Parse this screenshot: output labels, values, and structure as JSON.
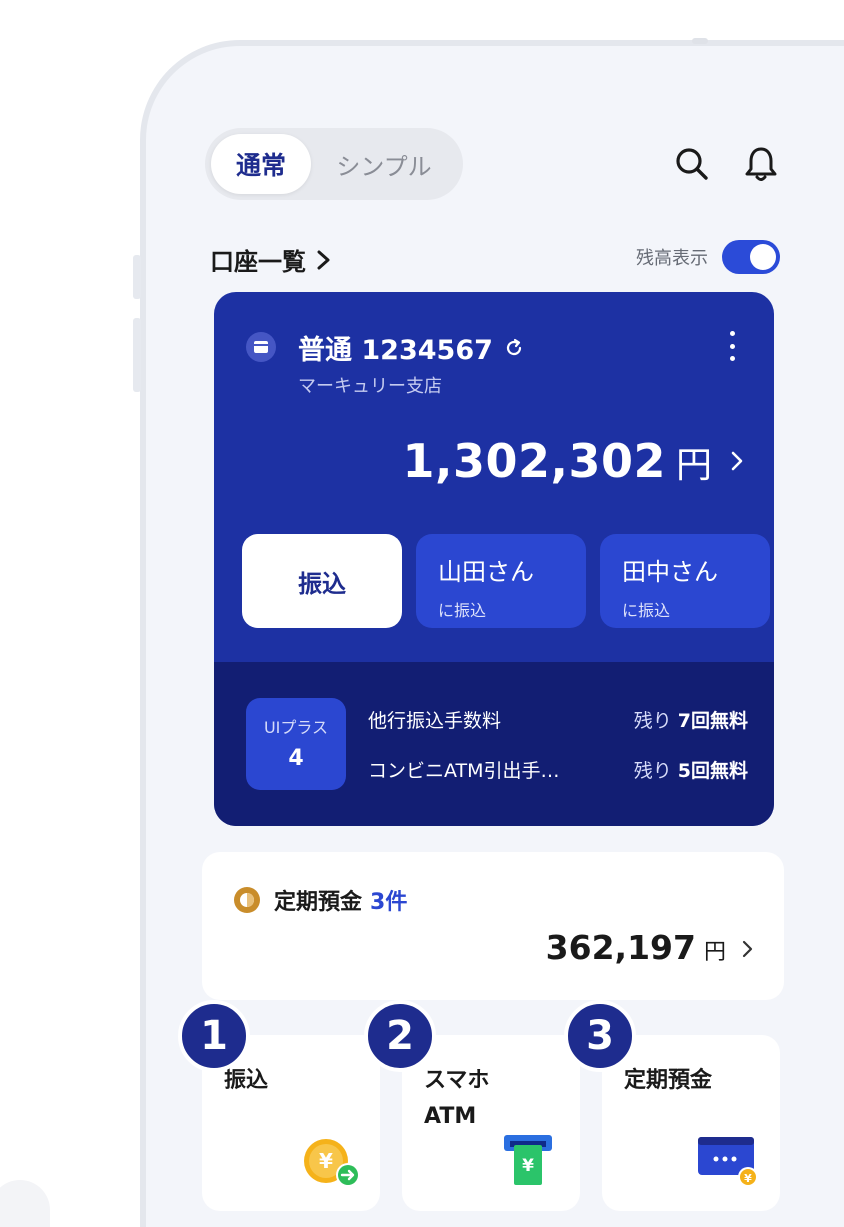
{
  "header": {
    "tabs": [
      {
        "label": "通常",
        "active": true
      },
      {
        "label": "シンプル",
        "active": false
      }
    ],
    "icons": [
      "search-icon",
      "bell-icon"
    ]
  },
  "accounts": {
    "link_label": "口座一覧",
    "balance_toggle_label": "残高表示",
    "balance_visible": true
  },
  "account_card": {
    "title": "普通 1234567",
    "branch": "マーキュリー支店",
    "amount": "1,302,302",
    "currency": "円",
    "transfer_label": "振込",
    "quick_transfers": [
      {
        "name": "山田さん",
        "sub": "に振込"
      },
      {
        "name": "田中さん",
        "sub": "に振込"
      }
    ],
    "plus": {
      "badge_label": "UIプラス",
      "badge_value": "4",
      "fees": [
        {
          "name": "他行振込手数料",
          "prefix": "残り",
          "count": "7回無料"
        },
        {
          "name": "コンビニATM引出手…",
          "prefix": "残り",
          "count": "5回無料"
        }
      ]
    }
  },
  "time_deposit": {
    "title": "定期預金",
    "count": "3件",
    "amount": "362,197",
    "currency": "円"
  },
  "services": [
    {
      "number": "1",
      "label": "振込"
    },
    {
      "number": "2",
      "label_line1": "スマホ",
      "label_line2": "ATM"
    },
    {
      "number": "3",
      "label": "定期預金"
    }
  ],
  "colors": {
    "primary": "#1d31a3",
    "primary_dark": "#121e73",
    "accent": "#2b47d1",
    "background": "#f3f5fa"
  }
}
